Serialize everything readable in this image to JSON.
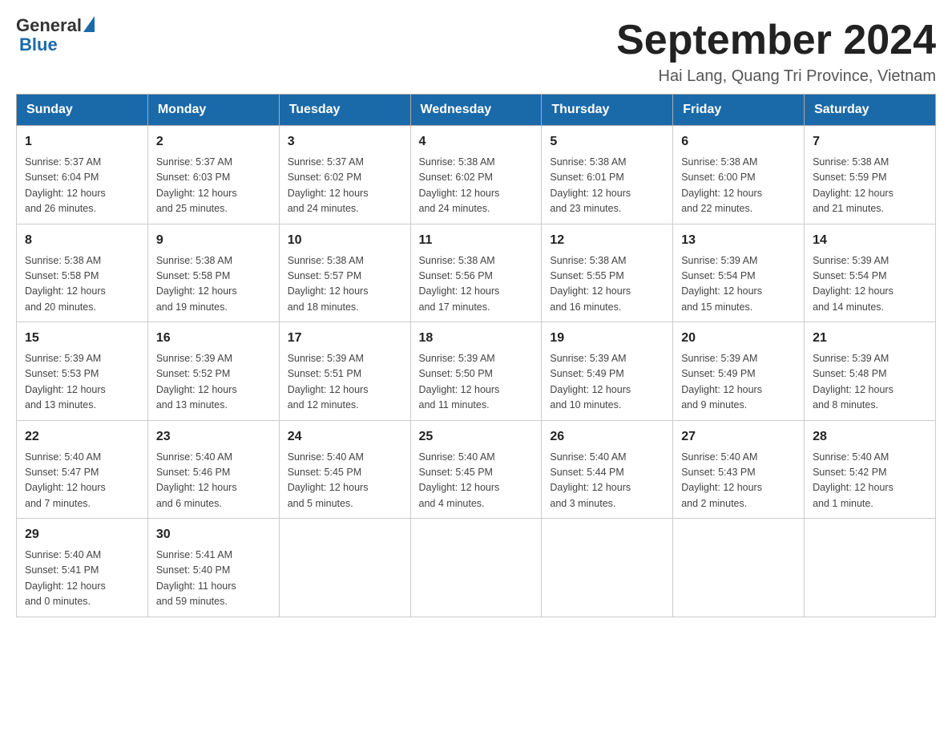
{
  "header": {
    "logo_general": "General",
    "logo_blue": "Blue",
    "title": "September 2024",
    "subtitle": "Hai Lang, Quang Tri Province, Vietnam"
  },
  "days_of_week": [
    "Sunday",
    "Monday",
    "Tuesday",
    "Wednesday",
    "Thursday",
    "Friday",
    "Saturday"
  ],
  "weeks": [
    [
      {
        "day": "1",
        "sunrise": "5:37 AM",
        "sunset": "6:04 PM",
        "daylight": "12 hours and 26 minutes."
      },
      {
        "day": "2",
        "sunrise": "5:37 AM",
        "sunset": "6:03 PM",
        "daylight": "12 hours and 25 minutes."
      },
      {
        "day": "3",
        "sunrise": "5:37 AM",
        "sunset": "6:02 PM",
        "daylight": "12 hours and 24 minutes."
      },
      {
        "day": "4",
        "sunrise": "5:38 AM",
        "sunset": "6:02 PM",
        "daylight": "12 hours and 24 minutes."
      },
      {
        "day": "5",
        "sunrise": "5:38 AM",
        "sunset": "6:01 PM",
        "daylight": "12 hours and 23 minutes."
      },
      {
        "day": "6",
        "sunrise": "5:38 AM",
        "sunset": "6:00 PM",
        "daylight": "12 hours and 22 minutes."
      },
      {
        "day": "7",
        "sunrise": "5:38 AM",
        "sunset": "5:59 PM",
        "daylight": "12 hours and 21 minutes."
      }
    ],
    [
      {
        "day": "8",
        "sunrise": "5:38 AM",
        "sunset": "5:58 PM",
        "daylight": "12 hours and 20 minutes."
      },
      {
        "day": "9",
        "sunrise": "5:38 AM",
        "sunset": "5:58 PM",
        "daylight": "12 hours and 19 minutes."
      },
      {
        "day": "10",
        "sunrise": "5:38 AM",
        "sunset": "5:57 PM",
        "daylight": "12 hours and 18 minutes."
      },
      {
        "day": "11",
        "sunrise": "5:38 AM",
        "sunset": "5:56 PM",
        "daylight": "12 hours and 17 minutes."
      },
      {
        "day": "12",
        "sunrise": "5:38 AM",
        "sunset": "5:55 PM",
        "daylight": "12 hours and 16 minutes."
      },
      {
        "day": "13",
        "sunrise": "5:39 AM",
        "sunset": "5:54 PM",
        "daylight": "12 hours and 15 minutes."
      },
      {
        "day": "14",
        "sunrise": "5:39 AM",
        "sunset": "5:54 PM",
        "daylight": "12 hours and 14 minutes."
      }
    ],
    [
      {
        "day": "15",
        "sunrise": "5:39 AM",
        "sunset": "5:53 PM",
        "daylight": "12 hours and 13 minutes."
      },
      {
        "day": "16",
        "sunrise": "5:39 AM",
        "sunset": "5:52 PM",
        "daylight": "12 hours and 13 minutes."
      },
      {
        "day": "17",
        "sunrise": "5:39 AM",
        "sunset": "5:51 PM",
        "daylight": "12 hours and 12 minutes."
      },
      {
        "day": "18",
        "sunrise": "5:39 AM",
        "sunset": "5:50 PM",
        "daylight": "12 hours and 11 minutes."
      },
      {
        "day": "19",
        "sunrise": "5:39 AM",
        "sunset": "5:49 PM",
        "daylight": "12 hours and 10 minutes."
      },
      {
        "day": "20",
        "sunrise": "5:39 AM",
        "sunset": "5:49 PM",
        "daylight": "12 hours and 9 minutes."
      },
      {
        "day": "21",
        "sunrise": "5:39 AM",
        "sunset": "5:48 PM",
        "daylight": "12 hours and 8 minutes."
      }
    ],
    [
      {
        "day": "22",
        "sunrise": "5:40 AM",
        "sunset": "5:47 PM",
        "daylight": "12 hours and 7 minutes."
      },
      {
        "day": "23",
        "sunrise": "5:40 AM",
        "sunset": "5:46 PM",
        "daylight": "12 hours and 6 minutes."
      },
      {
        "day": "24",
        "sunrise": "5:40 AM",
        "sunset": "5:45 PM",
        "daylight": "12 hours and 5 minutes."
      },
      {
        "day": "25",
        "sunrise": "5:40 AM",
        "sunset": "5:45 PM",
        "daylight": "12 hours and 4 minutes."
      },
      {
        "day": "26",
        "sunrise": "5:40 AM",
        "sunset": "5:44 PM",
        "daylight": "12 hours and 3 minutes."
      },
      {
        "day": "27",
        "sunrise": "5:40 AM",
        "sunset": "5:43 PM",
        "daylight": "12 hours and 2 minutes."
      },
      {
        "day": "28",
        "sunrise": "5:40 AM",
        "sunset": "5:42 PM",
        "daylight": "12 hours and 1 minute."
      }
    ],
    [
      {
        "day": "29",
        "sunrise": "5:40 AM",
        "sunset": "5:41 PM",
        "daylight": "12 hours and 0 minutes."
      },
      {
        "day": "30",
        "sunrise": "5:41 AM",
        "sunset": "5:40 PM",
        "daylight": "11 hours and 59 minutes."
      },
      null,
      null,
      null,
      null,
      null
    ]
  ],
  "labels": {
    "sunrise_prefix": "Sunrise: ",
    "sunset_prefix": "Sunset: ",
    "daylight_prefix": "Daylight: "
  }
}
